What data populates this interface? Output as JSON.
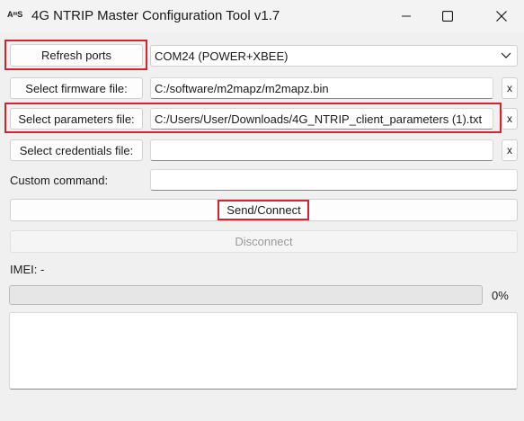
{
  "window": {
    "app_icon": "A^S",
    "title": "4G NTRIP Master Configuration Tool v1.7",
    "controls": [
      "minimize-icon",
      "maximize-icon",
      "close-icon"
    ]
  },
  "ports": {
    "refresh_label": "Refresh ports",
    "selected_port": "COM24 (POWER+XBEE)"
  },
  "firmware": {
    "button_label": "Select firmware file:",
    "path": "C:/software/m2mapz/m2mapz.bin",
    "clear_label": "x"
  },
  "parameters": {
    "button_label": "Select parameters file:",
    "path": "C:/Users/User/Downloads/4G_NTRIP_client_parameters (1).txt",
    "clear_label": "x"
  },
  "credentials": {
    "button_label": "Select credentials file:",
    "path": "",
    "clear_label": "x"
  },
  "custom_command": {
    "label": "Custom command:",
    "value": ""
  },
  "actions": {
    "send_connect_label": "Send/Connect",
    "disconnect_label": "Disconnect"
  },
  "status": {
    "imei_text": "IMEI: -",
    "progress_text": "0%",
    "progress_value": 0
  },
  "log": {
    "text": ""
  },
  "colors": {
    "highlight": "#d6232c",
    "background": "#f0f0f0"
  }
}
